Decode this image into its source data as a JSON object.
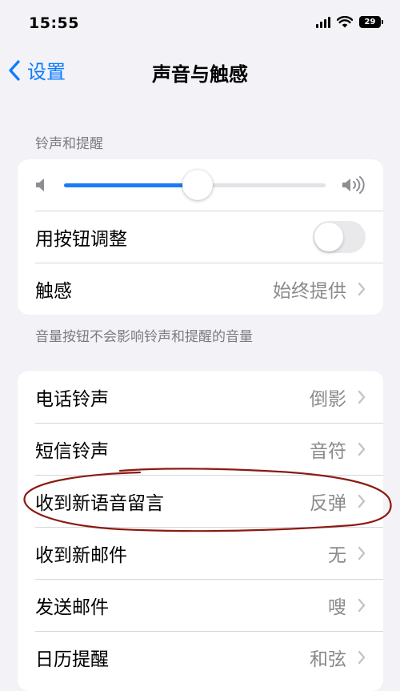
{
  "status_bar": {
    "time": "15:55",
    "battery": "29"
  },
  "nav": {
    "back_label": "设置",
    "title": "声音与触感"
  },
  "ringers_section": {
    "header": "铃声和提醒",
    "volume_level": 0.51,
    "adjust_with_buttons": {
      "label": "用按钮调整",
      "on": false
    },
    "haptics": {
      "label": "触感",
      "value": "始终提供"
    },
    "footer": "音量按钮不会影响铃声和提醒的音量"
  },
  "sounds": [
    {
      "label": "电话铃声",
      "value": "倒影"
    },
    {
      "label": "短信铃声",
      "value": "音符"
    },
    {
      "label": "收到新语音留言",
      "value": "反弹"
    },
    {
      "label": "收到新邮件",
      "value": "无"
    },
    {
      "label": "发送邮件",
      "value": "嗖"
    },
    {
      "label": "日历提醒",
      "value": "和弦"
    }
  ],
  "colors": {
    "accent": "#0a7aff",
    "slider_fill": "#1a7cf5",
    "annotation": "#8b1a12",
    "background": "#f2f2f7"
  }
}
